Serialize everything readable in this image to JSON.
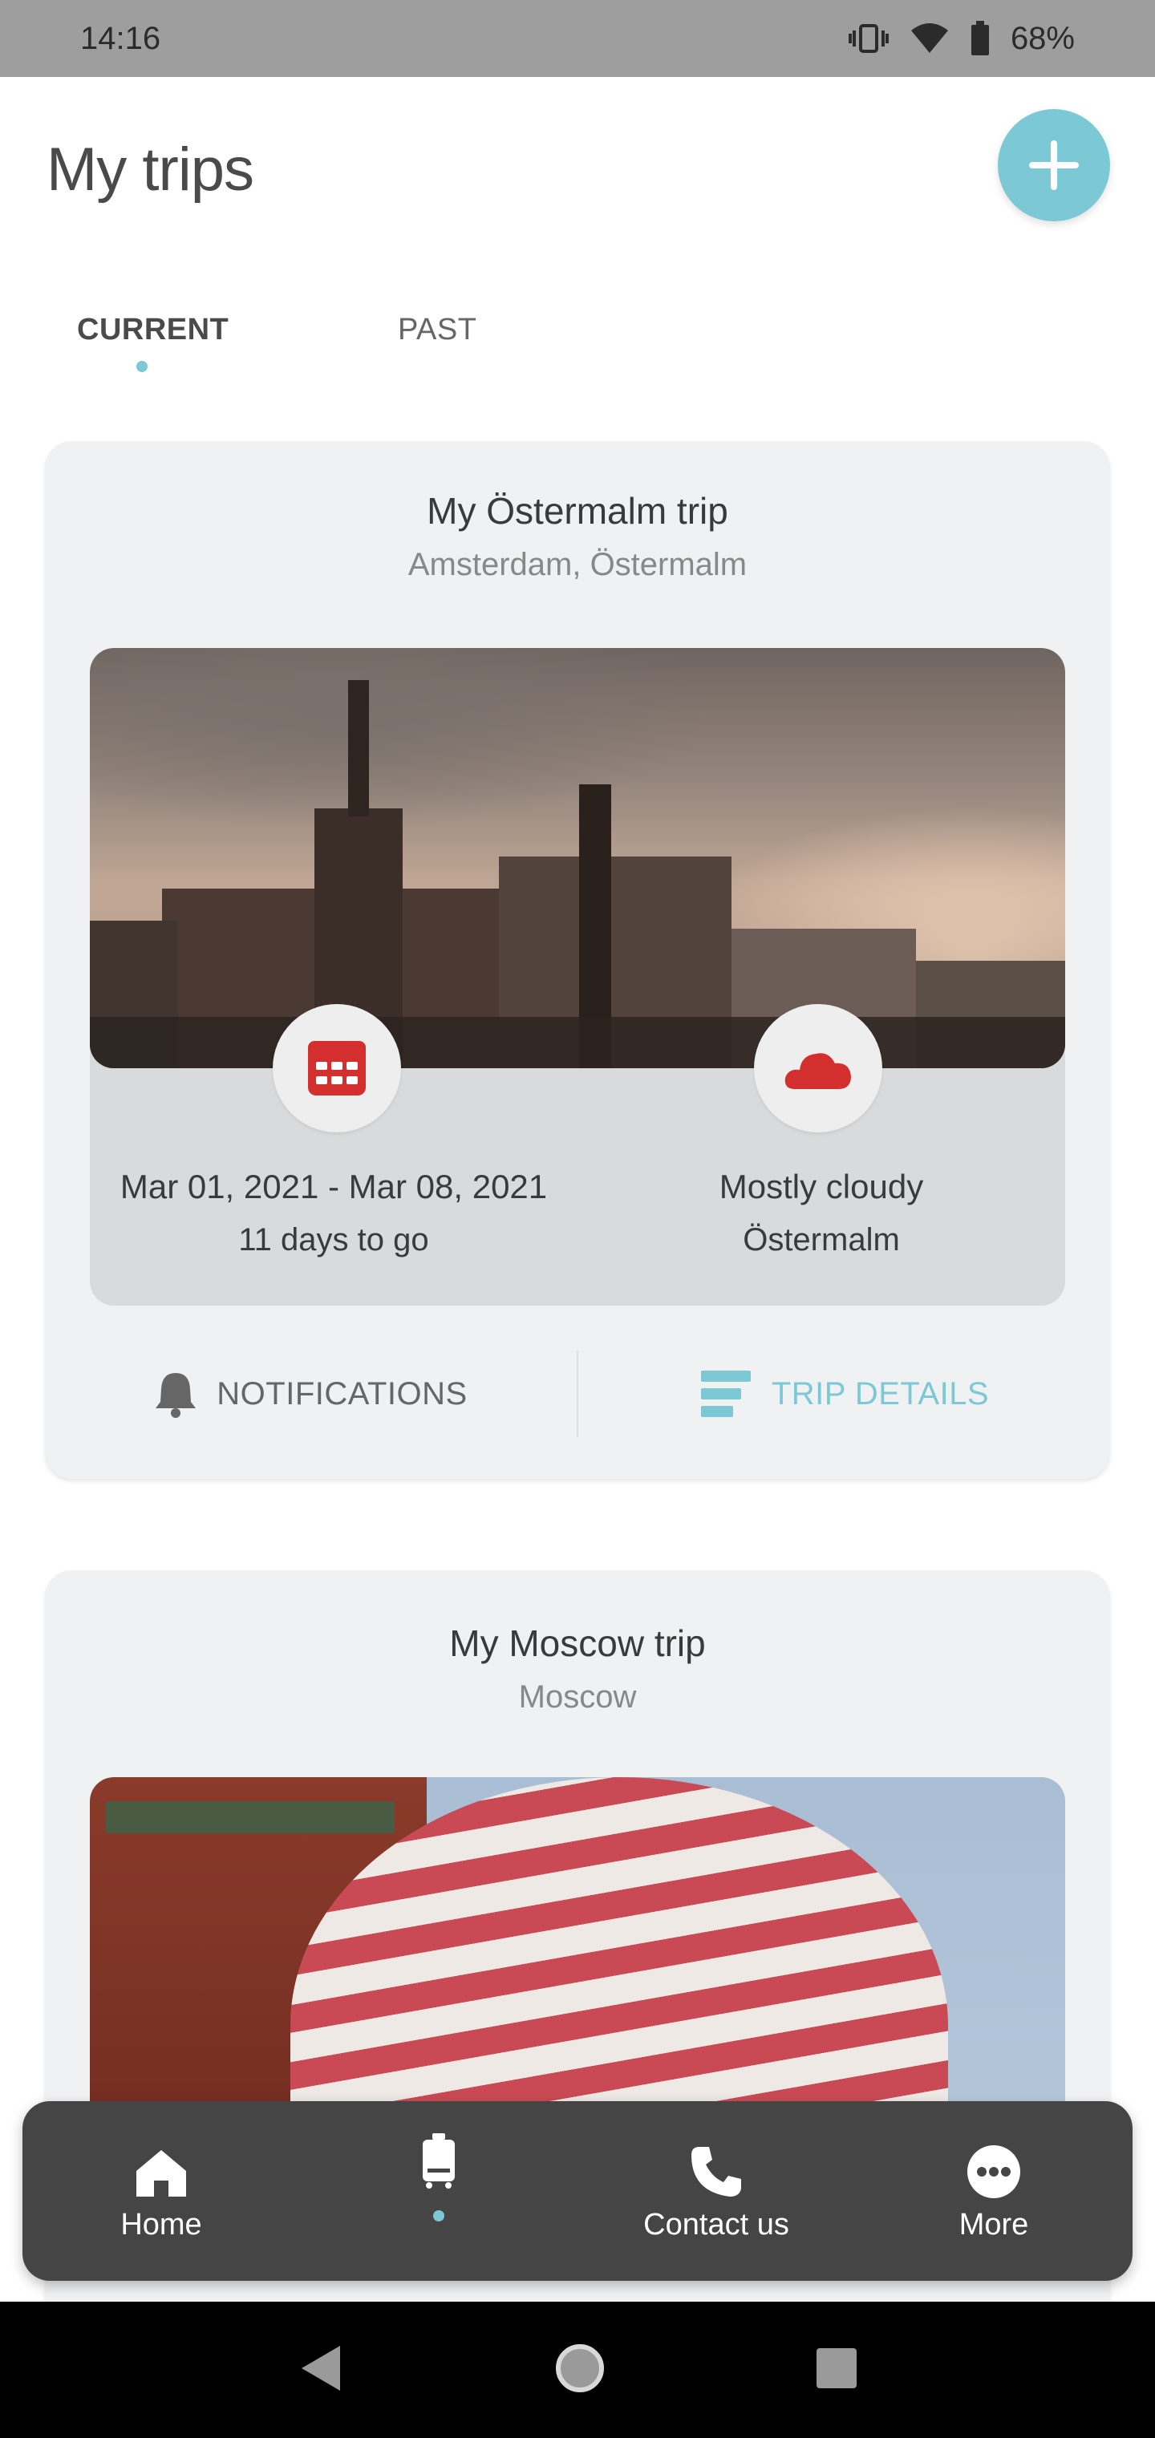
{
  "status_bar": {
    "time": "14:16",
    "battery": "68%"
  },
  "header": {
    "title": "My trips"
  },
  "tabs": [
    {
      "label": "CURRENT",
      "active": true
    },
    {
      "label": "PAST",
      "active": false
    }
  ],
  "trips": [
    {
      "title": "My Östermalm trip",
      "location": "Amsterdam, Östermalm",
      "dates": "Mar 01, 2021 - Mar 08, 2021",
      "countdown": "11 days to go",
      "weather": "Mostly cloudy",
      "weather_place": "Östermalm",
      "notifications_label": "NOTIFICATIONS",
      "details_label": "TRIP DETAILS"
    },
    {
      "title": "My Moscow trip",
      "location": "Moscow"
    }
  ],
  "bottom_nav": [
    {
      "label": "Home",
      "icon": "home-icon"
    },
    {
      "label": "",
      "icon": "luggage-icon",
      "active": true
    },
    {
      "label": "Contact us",
      "icon": "phone-icon"
    },
    {
      "label": "More",
      "icon": "more-icon"
    }
  ],
  "colors": {
    "accent": "#7cc9d5",
    "alert_red": "#d32f2f",
    "nav_bg": "#454545"
  }
}
